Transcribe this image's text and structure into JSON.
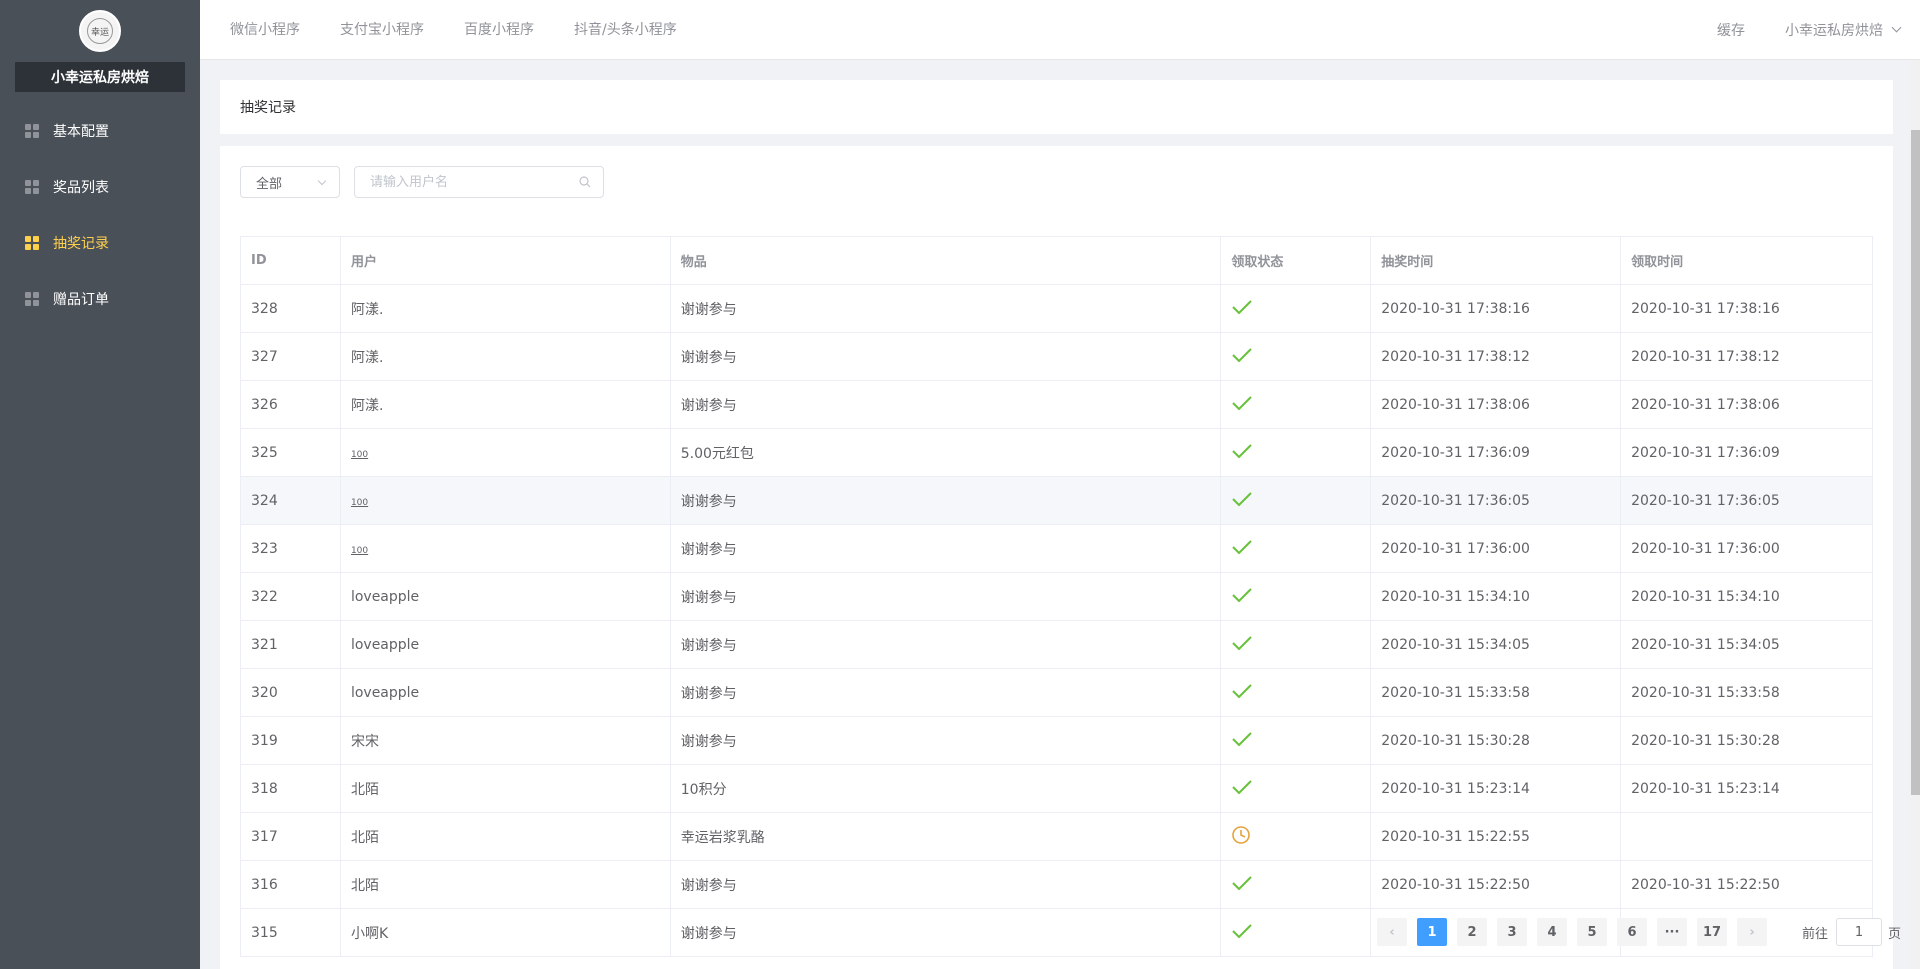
{
  "brand": {
    "logo_text": "幸运",
    "name": "小幸运私房烘焙"
  },
  "sidebar": {
    "items": [
      {
        "label": "基本配置",
        "icon": "grid-icon",
        "active": false
      },
      {
        "label": "奖品列表",
        "icon": "grid-icon",
        "active": false
      },
      {
        "label": "抽奖记录",
        "icon": "grid-icon",
        "active": true
      },
      {
        "label": "赠品订单",
        "icon": "grid-icon",
        "active": false
      }
    ]
  },
  "topbar": {
    "tabs": [
      "微信小程序",
      "支付宝小程序",
      "百度小程序",
      "抖音/头条小程序"
    ],
    "cache_label": "缓存",
    "user_label": "小幸运私房烘焙"
  },
  "page": {
    "title": "抽奖记录"
  },
  "filters": {
    "select_value": "全部",
    "search_placeholder": "请输入用户名"
  },
  "table": {
    "columns": [
      "ID",
      "用户",
      "物品",
      "领取状态",
      "抽奖时间",
      "领取时间"
    ],
    "rows": [
      {
        "id": "328",
        "user": "阿漾.",
        "item": "谢谢参与",
        "status": "claimed",
        "draw_time": "2020-10-31 17:38:16",
        "claim_time": "2020-10-31 17:38:16"
      },
      {
        "id": "327",
        "user": "阿漾.",
        "item": "谢谢参与",
        "status": "claimed",
        "draw_time": "2020-10-31 17:38:12",
        "claim_time": "2020-10-31 17:38:12"
      },
      {
        "id": "326",
        "user": "阿漾.",
        "item": "谢谢参与",
        "status": "claimed",
        "draw_time": "2020-10-31 17:38:06",
        "claim_time": "2020-10-31 17:38:06"
      },
      {
        "id": "325",
        "user": "100",
        "item": "5.00元红包",
        "status": "claimed",
        "draw_time": "2020-10-31 17:36:09",
        "claim_time": "2020-10-31 17:36:09"
      },
      {
        "id": "324",
        "user": "100",
        "item": "谢谢参与",
        "status": "claimed",
        "draw_time": "2020-10-31 17:36:05",
        "claim_time": "2020-10-31 17:36:05"
      },
      {
        "id": "323",
        "user": "100",
        "item": "谢谢参与",
        "status": "claimed",
        "draw_time": "2020-10-31 17:36:00",
        "claim_time": "2020-10-31 17:36:00"
      },
      {
        "id": "322",
        "user": "loveapple",
        "item": "谢谢参与",
        "status": "claimed",
        "draw_time": "2020-10-31 15:34:10",
        "claim_time": "2020-10-31 15:34:10"
      },
      {
        "id": "321",
        "user": "loveapple",
        "item": "谢谢参与",
        "status": "claimed",
        "draw_time": "2020-10-31 15:34:05",
        "claim_time": "2020-10-31 15:34:05"
      },
      {
        "id": "320",
        "user": "loveapple",
        "item": "谢谢参与",
        "status": "claimed",
        "draw_time": "2020-10-31 15:33:58",
        "claim_time": "2020-10-31 15:33:58"
      },
      {
        "id": "319",
        "user": "宋宋",
        "item": "谢谢参与",
        "status": "claimed",
        "draw_time": "2020-10-31 15:30:28",
        "claim_time": "2020-10-31 15:30:28"
      },
      {
        "id": "318",
        "user": "北陌",
        "item": "10积分",
        "status": "claimed",
        "draw_time": "2020-10-31 15:23:14",
        "claim_time": "2020-10-31 15:23:14"
      },
      {
        "id": "317",
        "user": "北陌",
        "item": "幸运岩浆乳酪",
        "status": "pending",
        "draw_time": "2020-10-31 15:22:55",
        "claim_time": ""
      },
      {
        "id": "316",
        "user": "北陌",
        "item": "谢谢参与",
        "status": "claimed",
        "draw_time": "2020-10-31 15:22:50",
        "claim_time": "2020-10-31 15:22:50"
      },
      {
        "id": "315",
        "user": "小啊K",
        "item": "谢谢参与",
        "status": "claimed",
        "draw_time": "",
        "claim_time": ""
      }
    ]
  },
  "pagination": {
    "pages": [
      "1",
      "2",
      "3",
      "4",
      "5",
      "6",
      "···",
      "17"
    ],
    "current": "1",
    "goto_label": "前往",
    "goto_value": "1",
    "page_suffix": "页"
  },
  "colors": {
    "accent": "#409eff",
    "active_menu": "#ffd04b",
    "success": "#67c23a",
    "warning": "#e6a23c"
  }
}
